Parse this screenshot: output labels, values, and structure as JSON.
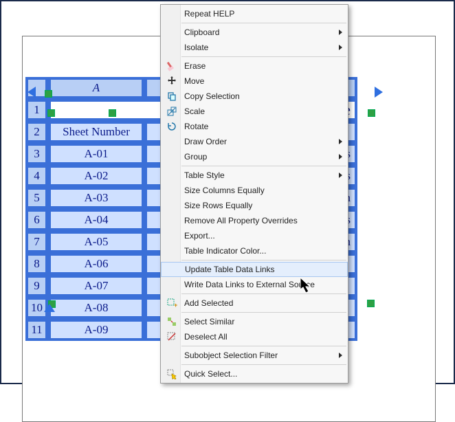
{
  "table": {
    "col_label_A": "A",
    "col_label_B": "",
    "title": "She",
    "header_A": "Sheet Number",
    "header_B": "",
    "rows": [
      {
        "n": "1"
      },
      {
        "n": "2"
      },
      {
        "n": "3",
        "a": "A-01",
        "b": "Plans"
      },
      {
        "n": "4",
        "a": "A-02",
        "b": "oms"
      },
      {
        "n": "5",
        "a": "A-03",
        "b": "lan"
      },
      {
        "n": "6",
        "a": "A-04",
        "b": "s"
      },
      {
        "n": "7",
        "a": "A-05",
        "b": "Plan"
      },
      {
        "n": "8",
        "a": "A-06",
        "b": ""
      },
      {
        "n": "9",
        "a": "A-07",
        "b": ""
      },
      {
        "n": "10",
        "a": "A-08",
        "b": ""
      },
      {
        "n": "11",
        "a": "A-09",
        "b": ""
      }
    ]
  },
  "menu": {
    "sections": [
      [
        {
          "label": "Repeat HELP",
          "icon": "",
          "sub": false
        }
      ],
      [
        {
          "label": "Clipboard",
          "icon": "",
          "sub": true
        },
        {
          "label": "Isolate",
          "icon": "",
          "sub": true
        }
      ],
      [
        {
          "label": "Erase",
          "icon": "erase",
          "sub": false
        },
        {
          "label": "Move",
          "icon": "move",
          "sub": false
        },
        {
          "label": "Copy Selection",
          "icon": "copy",
          "sub": false
        },
        {
          "label": "Scale",
          "icon": "scale",
          "sub": false
        },
        {
          "label": "Rotate",
          "icon": "rotate",
          "sub": false
        },
        {
          "label": "Draw Order",
          "icon": "",
          "sub": true
        },
        {
          "label": "Group",
          "icon": "",
          "sub": true
        }
      ],
      [
        {
          "label": "Table Style",
          "icon": "",
          "sub": true
        },
        {
          "label": "Size Columns Equally",
          "icon": "",
          "sub": false
        },
        {
          "label": "Size Rows Equally",
          "icon": "",
          "sub": false
        },
        {
          "label": "Remove All Property Overrides",
          "icon": "",
          "sub": false
        },
        {
          "label": "Export...",
          "icon": "",
          "sub": false
        },
        {
          "label": "Table Indicator Color...",
          "icon": "",
          "sub": false
        }
      ],
      [
        {
          "label": "Update Table Data Links",
          "icon": "",
          "sub": false,
          "hi": true
        },
        {
          "label": "Write Data Links to External Source",
          "icon": "",
          "sub": false
        }
      ],
      [
        {
          "label": "Add Selected",
          "icon": "addsel",
          "sub": false
        }
      ],
      [
        {
          "label": "Select Similar",
          "icon": "selsim",
          "sub": false
        },
        {
          "label": "Deselect All",
          "icon": "desel",
          "sub": false
        }
      ],
      [
        {
          "label": "Subobject Selection Filter",
          "icon": "",
          "sub": true
        }
      ],
      [
        {
          "label": "Quick Select...",
          "icon": "qsel",
          "sub": false
        }
      ]
    ]
  }
}
